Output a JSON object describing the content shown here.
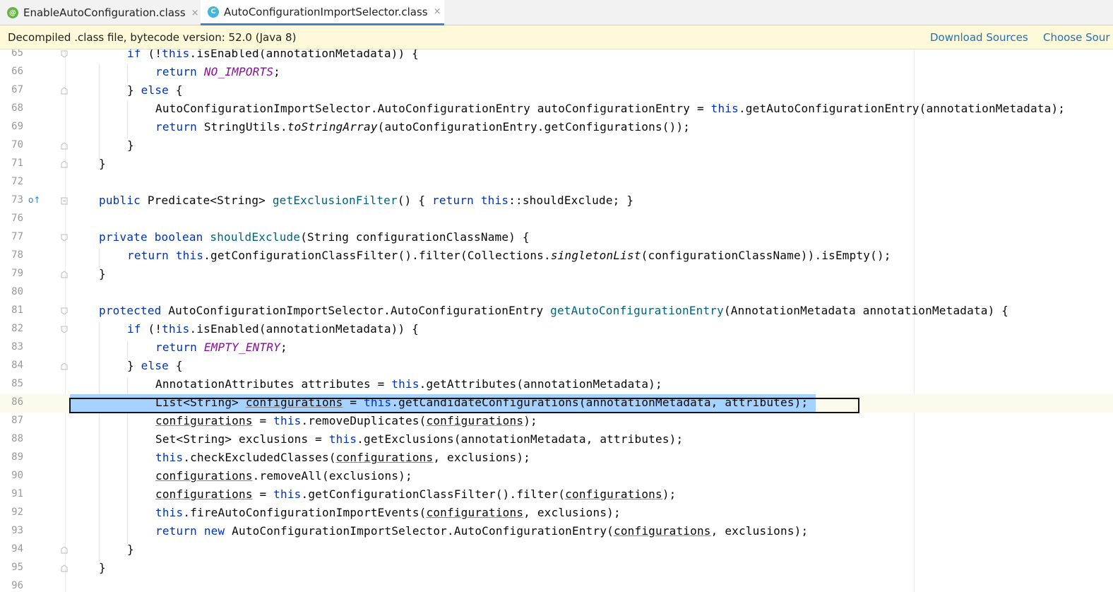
{
  "tabs": [
    {
      "label": "EnableAutoConfiguration.class",
      "icon": "annotation-icon",
      "icon_glyph": "@",
      "close": "×"
    },
    {
      "label": "AutoConfigurationImportSelector.class",
      "icon": "class-icon",
      "icon_glyph": "C",
      "close": "×"
    }
  ],
  "banner": {
    "text": "Decompiled .class file, bytecode version: 52.0 (Java 8)",
    "download_sources": "Download Sources",
    "choose_sources": "Choose Sour"
  },
  "lines": {
    "l65": "65",
    "l66": "66",
    "l67": "67",
    "l68": "68",
    "l69": "69",
    "l70": "70",
    "l71": "71",
    "l72": "72",
    "l73": "73",
    "l76": "76",
    "l77": "77",
    "l78": "78",
    "l79": "79",
    "l80": "80",
    "l81": "81",
    "l82": "82",
    "l83": "83",
    "l84": "84",
    "l85": "85",
    "l86": "86",
    "l87": "87",
    "l88": "88",
    "l89": "89",
    "l90": "90",
    "l91": "91",
    "l92": "92",
    "l93": "93",
    "l94": "94",
    "l95": "95",
    "l96": "96"
  },
  "code": {
    "c65": "if (!this.isEnabled(annotationMetadata)) {",
    "c66": "return NO_IMPORTS;",
    "c67": "} else {",
    "c68": "AutoConfigurationImportSelector.AutoConfigurationEntry autoConfigurationEntry = this.getAutoConfigurationEntry(annotationMetadata);",
    "c69": "return StringUtils.toStringArray(autoConfigurationEntry.getConfigurations());",
    "c70": "}",
    "c71": "}",
    "c73": "public Predicate<String> getExclusionFilter() { return this::shouldExclude; }",
    "c77": "private boolean shouldExclude(String configurationClassName) {",
    "c78": "return this.getConfigurationClassFilter().filter(Collections.singletonList(configurationClassName)).isEmpty();",
    "c79": "}",
    "c81": "protected AutoConfigurationImportSelector.AutoConfigurationEntry getAutoConfigurationEntry(AnnotationMetadata annotationMetadata) {",
    "c82": "if (!this.isEnabled(annotationMetadata)) {",
    "c83": "return EMPTY_ENTRY;",
    "c84": "} else {",
    "c85": "AnnotationAttributes attributes = this.getAttributes(annotationMetadata);",
    "c86": "List<String> configurations = this.getCandidateConfigurations(annotationMetadata, attributes);",
    "c87": "configurations = this.removeDuplicates(configurations);",
    "c88": "Set<String> exclusions = this.getExclusions(annotationMetadata, attributes);",
    "c89": "this.checkExcludedClasses(configurations, exclusions);",
    "c90": "configurations.removeAll(exclusions);",
    "c91": "configurations = this.getConfigurationClassFilter().filter(configurations);",
    "c92": "this.fireAutoConfigurationImportEvents(configurations, exclusions);",
    "c93": "return new AutoConfigurationImportSelector.AutoConfigurationEntry(configurations, exclusions);",
    "c94": "}",
    "c95": "}"
  },
  "override_marker": "o↑",
  "colors": {
    "keyword": "#0033b3",
    "method_decl": "#00627a",
    "constant": "#871094",
    "selection": "#a6d2ff",
    "link": "#2470b3"
  }
}
